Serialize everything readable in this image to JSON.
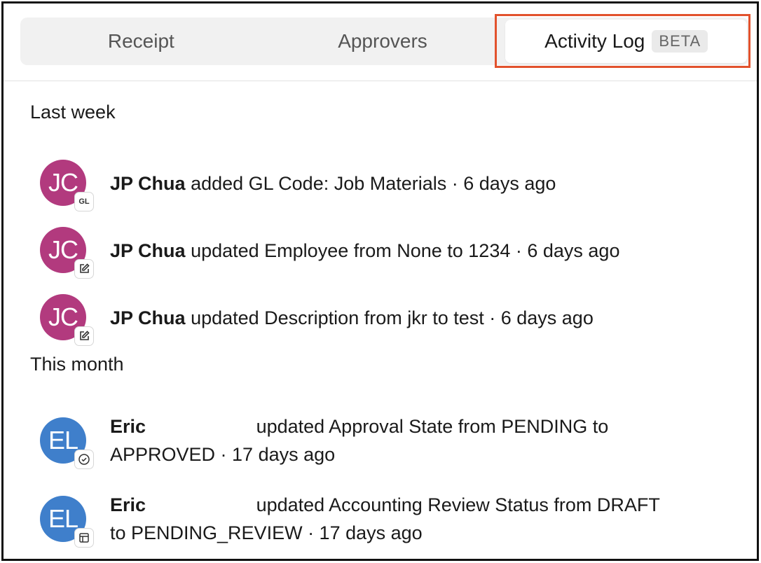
{
  "tabs": [
    {
      "label": "Receipt"
    },
    {
      "label": "Approvers"
    },
    {
      "label": "Activity Log",
      "badge": "BETA"
    }
  ],
  "sections": [
    {
      "title": "Last week"
    },
    {
      "title": "This month"
    }
  ],
  "entries": [
    {
      "initials": "JC",
      "badge": "GL",
      "actor": "JP Chua",
      "line1": "added GL Code: Job Materials · 6 days ago",
      "line2": ""
    },
    {
      "initials": "JC",
      "actor": "JP Chua",
      "line1": "updated Employee from None to 1234 · 6 days ago",
      "line2": ""
    },
    {
      "initials": "JC",
      "actor": "JP Chua",
      "line1": "updated Description from jkr to test · 6 days ago",
      "line2": ""
    },
    {
      "initials": "EL",
      "actor": "Eric",
      "line1": "updated Approval State from PENDING to",
      "line2": "APPROVED · 17 days ago"
    },
    {
      "initials": "EL",
      "actor": "Eric",
      "line1": "updated Accounting Review Status from DRAFT",
      "line2": "to PENDING_REVIEW · 17 days ago"
    }
  ],
  "colors": {
    "jc_avatar": "#b23a7e",
    "el_avatar": "#3f7fcb",
    "highlight": "#e2522d"
  },
  "icons": [
    "gl-badge-icon",
    "edit-icon",
    "check-circle-icon",
    "table-icon"
  ]
}
